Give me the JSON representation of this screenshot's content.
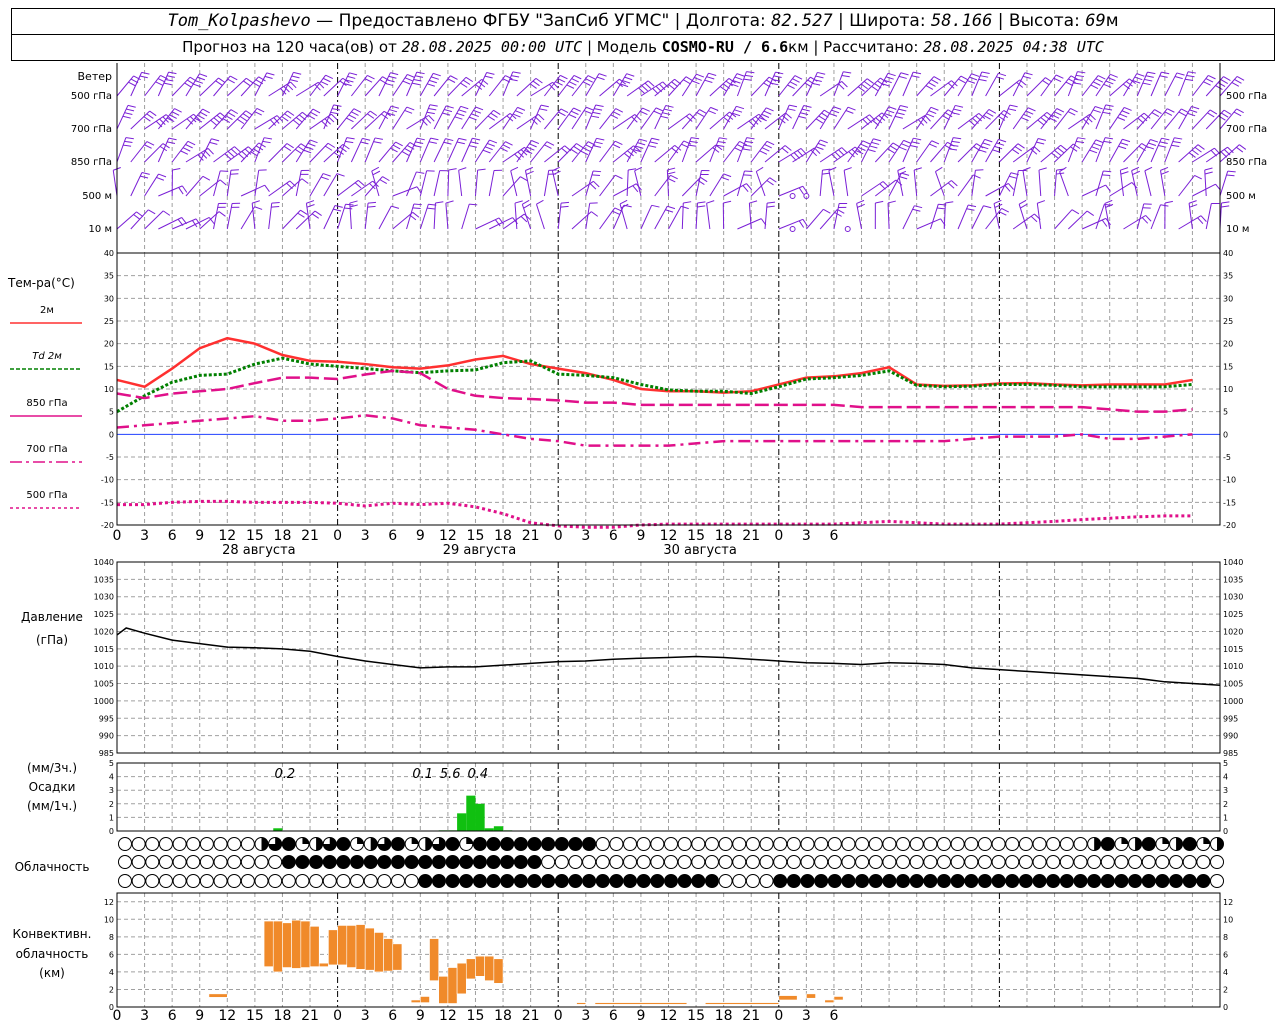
{
  "header": {
    "station": "Tom_Kolpashevo",
    "provider": " — Предоставлено ФГБУ \"ЗапСиб УГМС\" | Долгота: ",
    "longitude": "82.527",
    "lat_label": " | Широта: ",
    "latitude": "58.166",
    "alt_label": " | Высота: ",
    "altitude": "69",
    "alt_unit": "м",
    "forecast_label": "Прогноз на 120 часа(ов) от ",
    "forecast_from": "28.08.2025 00:00 UTC",
    "model_label": "  | Модель ",
    "model": "COSMO-RU / 6.6",
    "model_unit": "км",
    "calc_label": " | Рассчитано: ",
    "calc_time": "28.08.2025 04:38 UTC"
  },
  "wind_panel": {
    "title": "Ветер",
    "levels": [
      "500 гПа",
      "700 гПа",
      "850 гПа",
      "500 м",
      "10  м"
    ]
  },
  "temp_panel": {
    "title": "Тем-ра(°C)",
    "legend": [
      {
        "label": "2м",
        "color": "#ff3030",
        "dash": ""
      },
      {
        "label": "Td  2м",
        "color": "#008000",
        "dash": "4 2"
      },
      {
        "label": "850 гПа",
        "color": "#e0108a",
        "dash": ""
      },
      {
        "label": "700 гПа",
        "color": "#e0108a",
        "dash": "12 4 3 4"
      },
      {
        "label": "500 гПа",
        "color": "#e0108a",
        "dash": "3 3"
      }
    ],
    "y_ticks": [
      "40",
      "35",
      "30",
      "25",
      "20",
      "15",
      "10",
      "5",
      "0",
      "-5",
      "-10",
      "-15",
      "-20"
    ]
  },
  "x_axis": {
    "hour_labels": [
      "0",
      "3",
      "6",
      "9",
      "12",
      "15",
      "18",
      "21",
      "0",
      "3",
      "6",
      "9",
      "12",
      "15",
      "18",
      "21",
      "0",
      "3",
      "6",
      "9",
      "12",
      "15",
      "18",
      "21",
      "0",
      "3",
      "6"
    ],
    "dates": [
      "28 августа",
      "29 августа",
      "30 августа"
    ]
  },
  "pressure_panel": {
    "title": "Давление",
    "unit": "(гПа)",
    "y_ticks": [
      "1040",
      "1035",
      "1030",
      "1025",
      "1020",
      "1015",
      "1010",
      "1005",
      "1000",
      "995",
      "990",
      "985"
    ]
  },
  "precip_panel": {
    "unit3": "(мм/3ч.)",
    "title": "Осадки",
    "unit1": "(мм/1ч.)",
    "y_ticks": [
      "5",
      "4",
      "3",
      "2",
      "1",
      "0"
    ],
    "totals": [
      {
        "hour": 18,
        "label": "0.2"
      },
      {
        "hour": 33,
        "label": "0.1"
      },
      {
        "hour": 36,
        "label": "5.6"
      },
      {
        "hour": 39,
        "label": "0.4"
      }
    ]
  },
  "cloud_panel": {
    "title": "Облачность"
  },
  "conv_panel": {
    "title1": "Конвективн.",
    "title2": "облачность",
    "unit": "(км)",
    "y_ticks": [
      "12",
      "10",
      "8",
      "6",
      "4",
      "2",
      "0"
    ]
  },
  "colors": {
    "wind": "#7a1fd6",
    "precip": "#10c010",
    "convective": "#f08a2a",
    "grid": "#a0a0a0"
  },
  "chart_data": [
    {
      "type": "line",
      "title": "Тем-ра(°C)",
      "x_unit": "hours from 28.08.2025 00 UTC",
      "ylim": [
        -20,
        40
      ],
      "x": [
        0,
        3,
        6,
        9,
        12,
        15,
        18,
        21,
        24,
        27,
        30,
        33,
        36,
        39,
        42,
        45,
        48,
        51,
        54,
        57,
        60,
        63,
        66,
        69,
        72,
        75,
        78,
        81,
        84,
        87,
        90,
        93,
        96,
        99,
        102,
        105,
        108,
        111,
        114,
        117,
        120
      ],
      "series": [
        {
          "name": "2м",
          "values": [
            12,
            10.5,
            14.5,
            19,
            21.2,
            20,
            17.5,
            16.2,
            16,
            15.5,
            14.8,
            14.5,
            15.2,
            16.5,
            17.3,
            15.5,
            14.5,
            13.5,
            12,
            10,
            9.5,
            9.5,
            9.2,
            9.5,
            11,
            12.5,
            12.8,
            13.5,
            14.8,
            11,
            10.7,
            10.8,
            11.2,
            11.3,
            11,
            10.8,
            11,
            11,
            11,
            12
          ]
        },
        {
          "name": "Td  2м",
          "values": [
            5,
            8.5,
            11.5,
            13,
            13.3,
            15.5,
            16.8,
            15.5,
            15,
            14.5,
            14,
            13.6,
            14,
            14.2,
            15.8,
            16.2,
            13.3,
            13,
            12.5,
            11,
            9.8,
            9.5,
            9.5,
            9,
            10.5,
            12.2,
            12.5,
            13,
            14,
            10.8,
            10.5,
            10.6,
            11,
            11,
            10.8,
            10.5,
            10.5,
            10.5,
            10.5,
            11
          ]
        },
        {
          "name": "850 гПа",
          "values": [
            9,
            8,
            9,
            9.5,
            10,
            11.3,
            12.5,
            12.5,
            12.2,
            13.2,
            14,
            13.5,
            10,
            8.5,
            8,
            7.8,
            7.5,
            7,
            7,
            6.5,
            6.5,
            6.5,
            6.5,
            6.5,
            6.5,
            6.5,
            6.5,
            6,
            6,
            6,
            6,
            6,
            6,
            6,
            6,
            6,
            5.5,
            5,
            5,
            5.5
          ]
        },
        {
          "name": "700 гПа",
          "values": [
            1.5,
            2,
            2.5,
            3,
            3.5,
            4,
            3,
            3,
            3.5,
            4.2,
            3.5,
            2,
            1.5,
            1,
            0,
            -1,
            -1.5,
            -2.5,
            -2.5,
            -2.5,
            -2.5,
            -2,
            -1.5,
            -1.5,
            -1.5,
            -1.5,
            -1.5,
            -1.5,
            -1.5,
            -1.5,
            -1.5,
            -1,
            -0.5,
            -0.5,
            -0.5,
            0,
            -1,
            -1,
            -0.5,
            0
          ]
        },
        {
          "name": "500 гПа",
          "values": [
            -15.5,
            -15.5,
            -15,
            -14.8,
            -14.8,
            -15,
            -15,
            -15,
            -15.2,
            -15.8,
            -15.2,
            -15.5,
            -15.2,
            -16,
            -17.5,
            -19.5,
            -20.2,
            -20.5,
            -20.5,
            -20,
            -19.8,
            -19.8,
            -19.8,
            -19.8,
            -19.8,
            -19.8,
            -19.8,
            -19.5,
            -19.2,
            -19.5,
            -19.8,
            -19.8,
            -19.8,
            -19.5,
            -19.2,
            -18.8,
            -18.5,
            -18.2,
            -18,
            -18
          ]
        }
      ]
    },
    {
      "type": "line",
      "title": "Давление",
      "ylabel": "(гПа)",
      "ylim": [
        985,
        1040
      ],
      "x": [
        0,
        1,
        3,
        6,
        9,
        12,
        15,
        18,
        21,
        24,
        27,
        30,
        33,
        36,
        39,
        42,
        45,
        48,
        51,
        54,
        57,
        60,
        63,
        66,
        69,
        72,
        75,
        78,
        81,
        84,
        87,
        90,
        93,
        96,
        99,
        102,
        105,
        108,
        111,
        114,
        117,
        120
      ],
      "series": [
        {
          "name": "",
          "values": [
            1019,
            1021,
            1019.5,
            1017.5,
            1016.5,
            1015.5,
            1015.3,
            1015,
            1014.3,
            1012.8,
            1011.5,
            1010.5,
            1009.5,
            1009.8,
            1009.8,
            1010.3,
            1010.8,
            1011.3,
            1011.5,
            1012,
            1012.3,
            1012.5,
            1012.8,
            1012.5,
            1012,
            1011.5,
            1011,
            1010.8,
            1010.5,
            1011,
            1010.8,
            1010.5,
            1009.5,
            1009,
            1008.5,
            1008,
            1007.5,
            1007,
            1006.5,
            1005.5,
            1005,
            1004.5
          ]
        }
      ]
    },
    {
      "type": "bar",
      "title": "Осадки",
      "ylabel": "(мм/1ч.)",
      "ylim": [
        0,
        5
      ],
      "x": [
        17,
        35,
        36,
        37,
        38,
        39,
        40,
        41,
        42
      ],
      "values": [
        0.2,
        0.05,
        0.05,
        1.3,
        2.6,
        2.0,
        0.2,
        0.35,
        0.05
      ]
    },
    {
      "type": "bar",
      "title": "Конвективн. облачность",
      "ylabel": "(км)",
      "ylim": [
        0,
        13
      ],
      "x_unit": "hours from 28.08.2025 00 UTC",
      "segments": [
        {
          "x": [
            10,
            12
          ],
          "bottom": 1.1,
          "top": 1.5
        },
        {
          "x": [
            16,
            17
          ],
          "bottom": 4.6,
          "top": 9.8
        },
        {
          "x": [
            17,
            18
          ],
          "bottom": 4.0,
          "top": 9.8
        },
        {
          "x": [
            18,
            19
          ],
          "bottom": 4.5,
          "top": 9.6
        },
        {
          "x": [
            19,
            20
          ],
          "bottom": 4.4,
          "top": 9.9
        },
        {
          "x": [
            20,
            21
          ],
          "bottom": 4.5,
          "top": 9.8
        },
        {
          "x": [
            21,
            22
          ],
          "bottom": 4.6,
          "top": 9.2
        },
        {
          "x": [
            22,
            23
          ],
          "bottom": 4.6,
          "top": 5.0
        },
        {
          "x": [
            23,
            24
          ],
          "bottom": 4.8,
          "top": 8.8
        },
        {
          "x": [
            24,
            25
          ],
          "bottom": 4.8,
          "top": 9.3
        },
        {
          "x": [
            25,
            26
          ],
          "bottom": 4.5,
          "top": 9.3
        },
        {
          "x": [
            26,
            27
          ],
          "bottom": 4.3,
          "top": 9.4
        },
        {
          "x": [
            27,
            28
          ],
          "bottom": 4.2,
          "top": 9.0
        },
        {
          "x": [
            28,
            29
          ],
          "bottom": 4.0,
          "top": 8.5
        },
        {
          "x": [
            29,
            30
          ],
          "bottom": 4.1,
          "top": 7.8
        },
        {
          "x": [
            30,
            31
          ],
          "bottom": 4.2,
          "top": 7.2
        },
        {
          "x": [
            32,
            33
          ],
          "bottom": 0.5,
          "top": 0.8
        },
        {
          "x": [
            33,
            34
          ],
          "bottom": 0.5,
          "top": 1.2
        },
        {
          "x": [
            34,
            35
          ],
          "bottom": 3.0,
          "top": 7.8
        },
        {
          "x": [
            35,
            36
          ],
          "bottom": 0.4,
          "top": 3.5
        },
        {
          "x": [
            36,
            37
          ],
          "bottom": 0.4,
          "top": 4.5
        },
        {
          "x": [
            37,
            38
          ],
          "bottom": 1.5,
          "top": 5.0
        },
        {
          "x": [
            38,
            39
          ],
          "bottom": 3.2,
          "top": 5.5
        },
        {
          "x": [
            39,
            40
          ],
          "bottom": 3.5,
          "top": 5.8
        },
        {
          "x": [
            40,
            41
          ],
          "bottom": 3.0,
          "top": 5.8
        },
        {
          "x": [
            41,
            42
          ],
          "bottom": 2.7,
          "top": 5.5
        },
        {
          "x": [
            50,
            51
          ],
          "bottom": 0.3,
          "top": 0.5
        },
        {
          "x": [
            52,
            62
          ],
          "bottom": 0.3,
          "top": 0.5
        },
        {
          "x": [
            64,
            72
          ],
          "bottom": 0.3,
          "top": 0.5
        },
        {
          "x": [
            72,
            74
          ],
          "bottom": 0.8,
          "top": 1.3
        },
        {
          "x": [
            75,
            76
          ],
          "bottom": 1.0,
          "top": 1.5
        },
        {
          "x": [
            77,
            78
          ],
          "bottom": 0.5,
          "top": 0.8
        },
        {
          "x": [
            78,
            79
          ],
          "bottom": 0.8,
          "top": 1.2
        }
      ]
    }
  ]
}
